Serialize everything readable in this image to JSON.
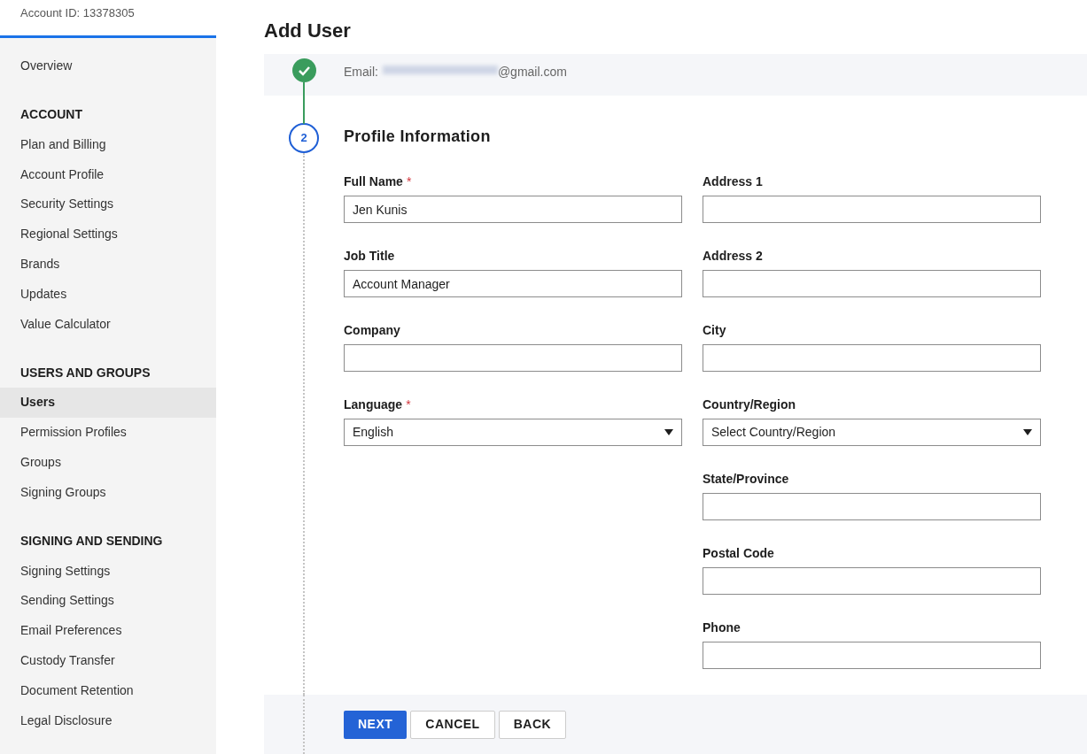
{
  "account_id": "Account ID: 13378305",
  "sidebar": {
    "sections": [
      {
        "items": [
          {
            "label": "Overview",
            "selected": false
          }
        ]
      },
      {
        "heading": "ACCOUNT",
        "items": [
          {
            "label": "Plan and Billing",
            "selected": false
          },
          {
            "label": "Account Profile",
            "selected": false
          },
          {
            "label": "Security Settings",
            "selected": false
          },
          {
            "label": "Regional Settings",
            "selected": false
          },
          {
            "label": "Brands",
            "selected": false
          },
          {
            "label": "Updates",
            "selected": false
          },
          {
            "label": "Value Calculator",
            "selected": false
          }
        ]
      },
      {
        "heading": "USERS AND GROUPS",
        "items": [
          {
            "label": "Users",
            "selected": true
          },
          {
            "label": "Permission Profiles",
            "selected": false
          },
          {
            "label": "Groups",
            "selected": false
          },
          {
            "label": "Signing Groups",
            "selected": false
          }
        ]
      },
      {
        "heading": "SIGNING AND SENDING",
        "items": [
          {
            "label": "Signing Settings",
            "selected": false
          },
          {
            "label": "Sending Settings",
            "selected": false
          },
          {
            "label": "Email Preferences",
            "selected": false
          },
          {
            "label": "Custody Transfer",
            "selected": false
          },
          {
            "label": "Document Retention",
            "selected": false
          },
          {
            "label": "Legal Disclosure",
            "selected": false
          }
        ]
      }
    ]
  },
  "title": "Add User",
  "steps": [
    {
      "completed": true,
      "email_label": "Email:",
      "email_domain": "@gmail.com"
    },
    {
      "completed": false,
      "number": "2",
      "heading": "Profile Information"
    }
  ],
  "form": {
    "columns": [
      [
        {
          "label": "Full Name",
          "required_mark": "*",
          "kind": "text",
          "value": "Jen Kunis"
        },
        {
          "label": "Job Title",
          "kind": "text",
          "value": "Account Manager"
        },
        {
          "label": "Company",
          "kind": "text"
        },
        {
          "label": "Language",
          "required_mark": "*",
          "kind": "select",
          "value": "English"
        }
      ],
      [
        {
          "label": "Address 1",
          "kind": "text"
        },
        {
          "label": "Address 2",
          "kind": "text"
        },
        {
          "label": "City",
          "kind": "text"
        },
        {
          "label": "Country/Region",
          "kind": "select",
          "value": "Select Country/Region"
        },
        {
          "label": "State/Province",
          "kind": "text"
        },
        {
          "label": "Postal Code",
          "kind": "text"
        },
        {
          "label": "Phone",
          "kind": "text"
        }
      ]
    ]
  },
  "buttons": [
    {
      "label": "NEXT",
      "kind": "primary"
    },
    {
      "label": "CANCEL",
      "kind": "secondary"
    },
    {
      "label": "BACK",
      "kind": "secondary"
    }
  ]
}
